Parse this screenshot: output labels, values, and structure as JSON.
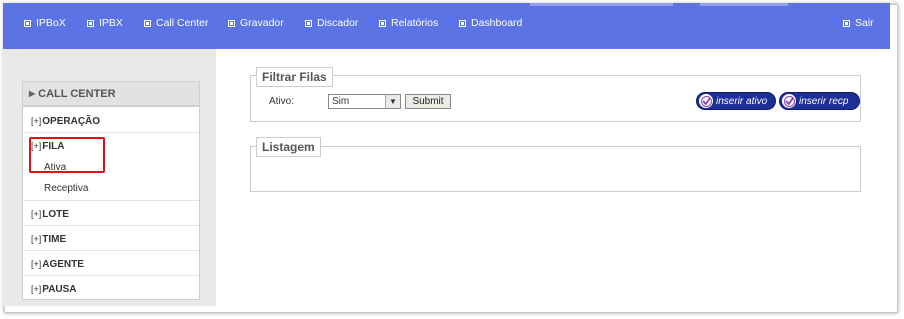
{
  "topnav": {
    "items": [
      {
        "label": "IPBoX"
      },
      {
        "label": "IPBX"
      },
      {
        "label": "Call Center"
      },
      {
        "label": "Gravador"
      },
      {
        "label": "Discador"
      },
      {
        "label": "Relatórios"
      },
      {
        "label": "Dashboard"
      }
    ],
    "logout_label": "Sair",
    "bg_color": "#5b73e3"
  },
  "sidebar": {
    "header": "CALL CENTER",
    "items": [
      {
        "prefix": "[+]",
        "label": "OPERAÇÃO"
      },
      {
        "prefix": "[+]",
        "label": "FILA",
        "children": [
          "Ativa",
          "Receptiva"
        ]
      },
      {
        "prefix": "[+]",
        "label": "LOTE"
      },
      {
        "prefix": "[+]",
        "label": "TIME"
      },
      {
        "prefix": "[+]",
        "label": "AGENTE"
      },
      {
        "prefix": "[+]",
        "label": "PAUSA"
      }
    ],
    "highlight_color": "#e0101a"
  },
  "filter": {
    "legend": "Filtrar Filas",
    "ativo_label": "Ativo:",
    "ativo_value": "Sim",
    "submit_label": "Submit",
    "insert_active_label": "inserir ativo",
    "insert_recp_label": "inserir recp",
    "pill_color": "#1c2f96"
  },
  "listing": {
    "legend": "Listagem"
  }
}
